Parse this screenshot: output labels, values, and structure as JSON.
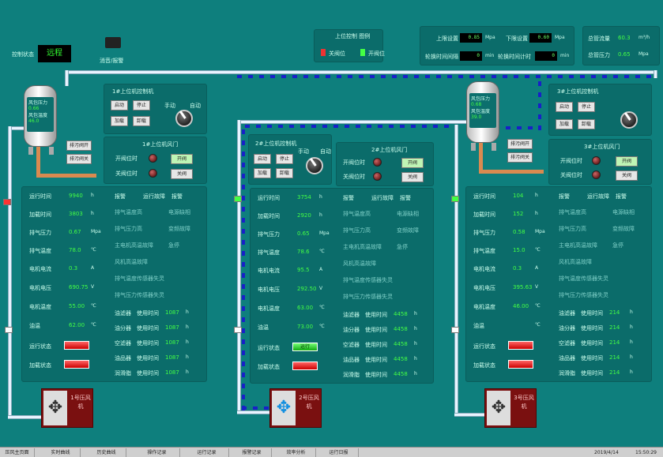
{
  "header": {
    "control_mode_label": "控制状态",
    "control_mode_value": "远程",
    "mute_label": "消音/报警"
  },
  "upper_panel": {
    "title": "上位控制 图例",
    "legend_closed": "关阀位",
    "legend_open": "开阀位"
  },
  "top_params": {
    "upper_set_label": "上限设置",
    "upper_set_value": "0.85",
    "lower_set_label": "下限设置",
    "lower_set_value": "0.60",
    "unit": "Mpa",
    "switch_interval_label": "轮换时间间隔",
    "switch_interval_value": "0",
    "switch_interval_unit": "min",
    "switch_time_label": "轮换时间计时",
    "switch_time_value": "0",
    "switch_time_unit": "min"
  },
  "right_top": {
    "flow_label": "总管流量",
    "flow_value": "60.3",
    "flow_unit": "m³/h",
    "pressure_label": "总管压力",
    "pressure_value": "0.65",
    "pressure_unit": "Mpa"
  },
  "compressors": [
    {
      "tank_lines": [
        "风包压力",
        "0.66",
        "Mpa",
        "风包温度",
        "46.0",
        "℃"
      ],
      "valve_btn1": "排污阀开",
      "valve_btn2": "排污阀关",
      "ctrl_title": "1#上位机控制机",
      "btns": [
        "启动",
        "停止",
        "加载",
        "卸载"
      ],
      "knob_manual": "手动",
      "knob_auto": "自动",
      "valve_title": "1#上位机风门",
      "open_label": "开阀位时",
      "close_label": "关阀位时",
      "open_btn": "开阀",
      "close_btn": "关阀",
      "params": [
        [
          "运行时间",
          "9940",
          "h"
        ],
        [
          "加载时间",
          "3803",
          "h"
        ],
        [
          "排气压力",
          "0.67",
          "Mpa"
        ],
        [
          "排气温度",
          "78.0",
          "℃"
        ],
        [
          "电机电流",
          "0.3",
          "A"
        ],
        [
          "电机电压",
          "690.75",
          "V"
        ],
        [
          "电机温度",
          "55.00",
          "℃"
        ],
        [
          "油温",
          "62.00",
          "℃"
        ],
        [
          "运行状态",
          "",
          " "
        ],
        [
          "加载状态",
          "",
          ""
        ]
      ],
      "run_status": "",
      "load_status": "",
      "alarm_headers": [
        "报警",
        "运行故障",
        "报警"
      ],
      "alarms": [
        [
          "排气温度高",
          "电源缺相"
        ],
        [
          "排气压力高",
          "变频故障"
        ],
        [
          "主电机高温故障",
          "急停"
        ],
        [
          "风机高温故障",
          ""
        ],
        [
          "排气温度传感器失灵",
          ""
        ],
        [
          "排气压力传感器失灵",
          ""
        ]
      ],
      "maint": [
        [
          "油滤器",
          "使用时间",
          "1087",
          "h"
        ],
        [
          "油分器",
          "使用时间",
          "1087",
          "h"
        ],
        [
          "空滤器",
          "使用时间",
          "1087",
          "h"
        ],
        [
          "油品器",
          "使用时间",
          "1087",
          "h"
        ],
        [
          "润滑脂",
          "使用时间",
          "1087",
          "h"
        ]
      ],
      "comp_label": "1号压风机"
    },
    {
      "tank_lines": [],
      "valve_btn1": "",
      "valve_btn2": "",
      "ctrl_title": "2#上位机控制机",
      "btns": [
        "启动",
        "停止",
        "加载",
        "卸载"
      ],
      "knob_manual": "手动",
      "knob_auto": "自动",
      "valve_title": "2#上位机风门",
      "open_label": "开阀位时",
      "close_label": "关阀位时",
      "open_btn": "开阀",
      "close_btn": "关阀",
      "params": [
        [
          "运行时间",
          "3754",
          "h"
        ],
        [
          "加载时间",
          "2920",
          "h"
        ],
        [
          "排气压力",
          "0.65",
          "Mpa"
        ],
        [
          "排气温度",
          "78.6",
          "℃"
        ],
        [
          "电机电流",
          "95.5",
          "A"
        ],
        [
          "电机电压",
          "292.50",
          "V"
        ],
        [
          "电机温度",
          "63.00",
          "℃"
        ],
        [
          "油温",
          "73.00",
          "℃"
        ],
        [
          "运行状态",
          "",
          ""
        ],
        [
          "加载状态",
          "",
          ""
        ]
      ],
      "run_status": "运行",
      "load_status": "",
      "alarm_headers": [
        "报警",
        "运行故障",
        "报警"
      ],
      "alarms": [
        [
          "排气温度高",
          "电源缺相"
        ],
        [
          "排气压力高",
          "变频故障"
        ],
        [
          "主电机高温故障",
          "急停"
        ],
        [
          "风机高温故障",
          ""
        ],
        [
          "排气温度传感器失灵",
          ""
        ],
        [
          "排气压力传感器失灵",
          ""
        ]
      ],
      "maint": [
        [
          "油滤器",
          "使用时间",
          "4458",
          "h"
        ],
        [
          "油分器",
          "使用时间",
          "4458",
          "h"
        ],
        [
          "空滤器",
          "使用时间",
          "4458",
          "h"
        ],
        [
          "油品器",
          "使用时间",
          "4458",
          "h"
        ],
        [
          "润滑脂",
          "使用时间",
          "4458",
          "h"
        ]
      ],
      "comp_label": "2号压风机"
    },
    {
      "tank_lines": [
        "风包压力",
        "0.68",
        "Mpa",
        "风包温度",
        "39.0",
        "℃"
      ],
      "valve_btn1": "排污阀开",
      "valve_btn2": "排污阀关",
      "ctrl_title": "3#上位机控制机",
      "btns": [
        "启动",
        "停止",
        "加载",
        "卸载"
      ],
      "knob_manual": "",
      "knob_auto": "",
      "valve_title": "3#上位机风门",
      "open_label": "开阀位时",
      "close_label": "关阀位时",
      "open_btn": "开阀",
      "close_btn": "关阀",
      "params": [
        [
          "运行时间",
          "104",
          "h"
        ],
        [
          "加载时间",
          "152",
          "h"
        ],
        [
          "排气压力",
          "0.58",
          "Mpa"
        ],
        [
          "排气温度",
          "15.0",
          "℃"
        ],
        [
          "电机电流",
          "0.3",
          "A"
        ],
        [
          "电机电压",
          "395.63",
          "V"
        ],
        [
          "电机温度",
          "46.00",
          "℃"
        ],
        [
          "油温",
          "",
          "℃"
        ],
        [
          "运行状态",
          "",
          ""
        ],
        [
          "加载状态",
          "",
          ""
        ]
      ],
      "run_status": "",
      "load_status": "",
      "alarm_headers": [
        "报警",
        "运行故障",
        "报警"
      ],
      "alarms": [
        [
          "排气温度高",
          "电源缺相"
        ],
        [
          "排气压力高",
          "变频故障"
        ],
        [
          "主电机高温故障",
          "急停"
        ],
        [
          "风机高温故障",
          ""
        ],
        [
          "排气温度传感器失灵",
          ""
        ],
        [
          "排气压力传感器失灵",
          ""
        ]
      ],
      "maint": [
        [
          "油滤器",
          "使用时间",
          "214",
          "h"
        ],
        [
          "油分器",
          "使用时间",
          "214",
          "h"
        ],
        [
          "空滤器",
          "使用时间",
          "214",
          "h"
        ],
        [
          "油品器",
          "使用时间",
          "214",
          "h"
        ],
        [
          "润滑脂",
          "使用时间",
          "214",
          "h"
        ]
      ],
      "comp_label": "3号压风机"
    }
  ],
  "statusbar": {
    "tabs": [
      "压风主页面",
      "实时曲线",
      "历史曲线",
      "操作记录",
      "运行记录",
      "报警记录",
      "效率分析",
      "运行日报"
    ],
    "date": "2019/4/14",
    "time": "15:50:29"
  }
}
